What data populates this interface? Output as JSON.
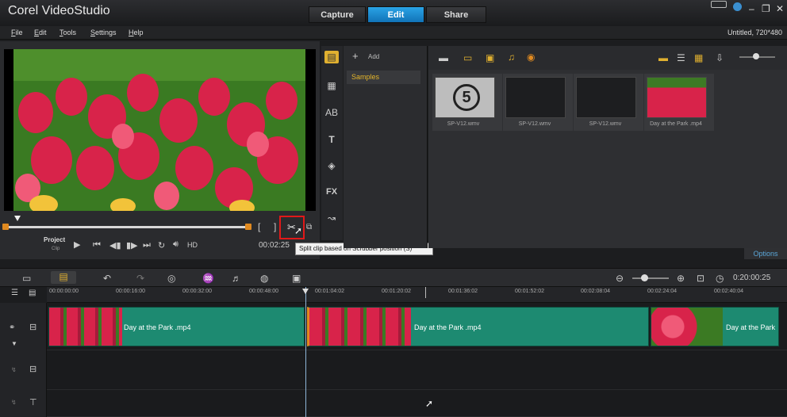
{
  "app": {
    "title": "Corel VideoStudio"
  },
  "tabs": [
    {
      "label": "Capture"
    },
    {
      "label": "Edit",
      "active": true
    },
    {
      "label": "Share"
    }
  ],
  "window_controls": {
    "minimize": "–",
    "restore": "❐",
    "close": "✕"
  },
  "menu": {
    "items": [
      {
        "letter": "F",
        "rest": "ile"
      },
      {
        "letter": "E",
        "rest": "dit"
      },
      {
        "letter": "T",
        "rest": "ools"
      },
      {
        "letter": "S",
        "rest": "ettings"
      },
      {
        "letter": "H",
        "rest": "elp"
      }
    ],
    "project_info": "Untitled, 720*480"
  },
  "preview": {
    "project_label": "Project",
    "clip_label": "Clip",
    "hd_label": "HD",
    "timecode": "00:02:25",
    "mark_in": "[",
    "mark_out": "]"
  },
  "tooltip": {
    "text": "Split clip based on Scrubber position (S)"
  },
  "library": {
    "add_label": "Add",
    "folder": "Samples",
    "options_label": "Options",
    "items": [
      {
        "caption": "SP-V12.wmv",
        "label": "5"
      },
      {
        "caption": "SP-V12.wmv"
      },
      {
        "caption": "SP-V12.wmv"
      },
      {
        "caption": "Day at the Park .mp4"
      }
    ]
  },
  "timeline": {
    "zoom_timecode": "0:20:00:25",
    "ruler": [
      "00:00:00:00",
      "00:00:16:00",
      "00:00:32:00",
      "00:00:48:00",
      "00:01:04:02",
      "00:01:20:02",
      "00:01:36:02",
      "00:01:52:02",
      "00:02:08:04",
      "00:02:24:04",
      "00:02:40:04"
    ],
    "clips": [
      {
        "label": "Day at the Park .mp4"
      },
      {
        "label": "Day at the Park .mp4"
      },
      {
        "label": "Day at the Park"
      }
    ]
  },
  "colors": {
    "accent": "#1a8fd6",
    "clip": "#1d8a71",
    "highlight": "#e01919"
  }
}
